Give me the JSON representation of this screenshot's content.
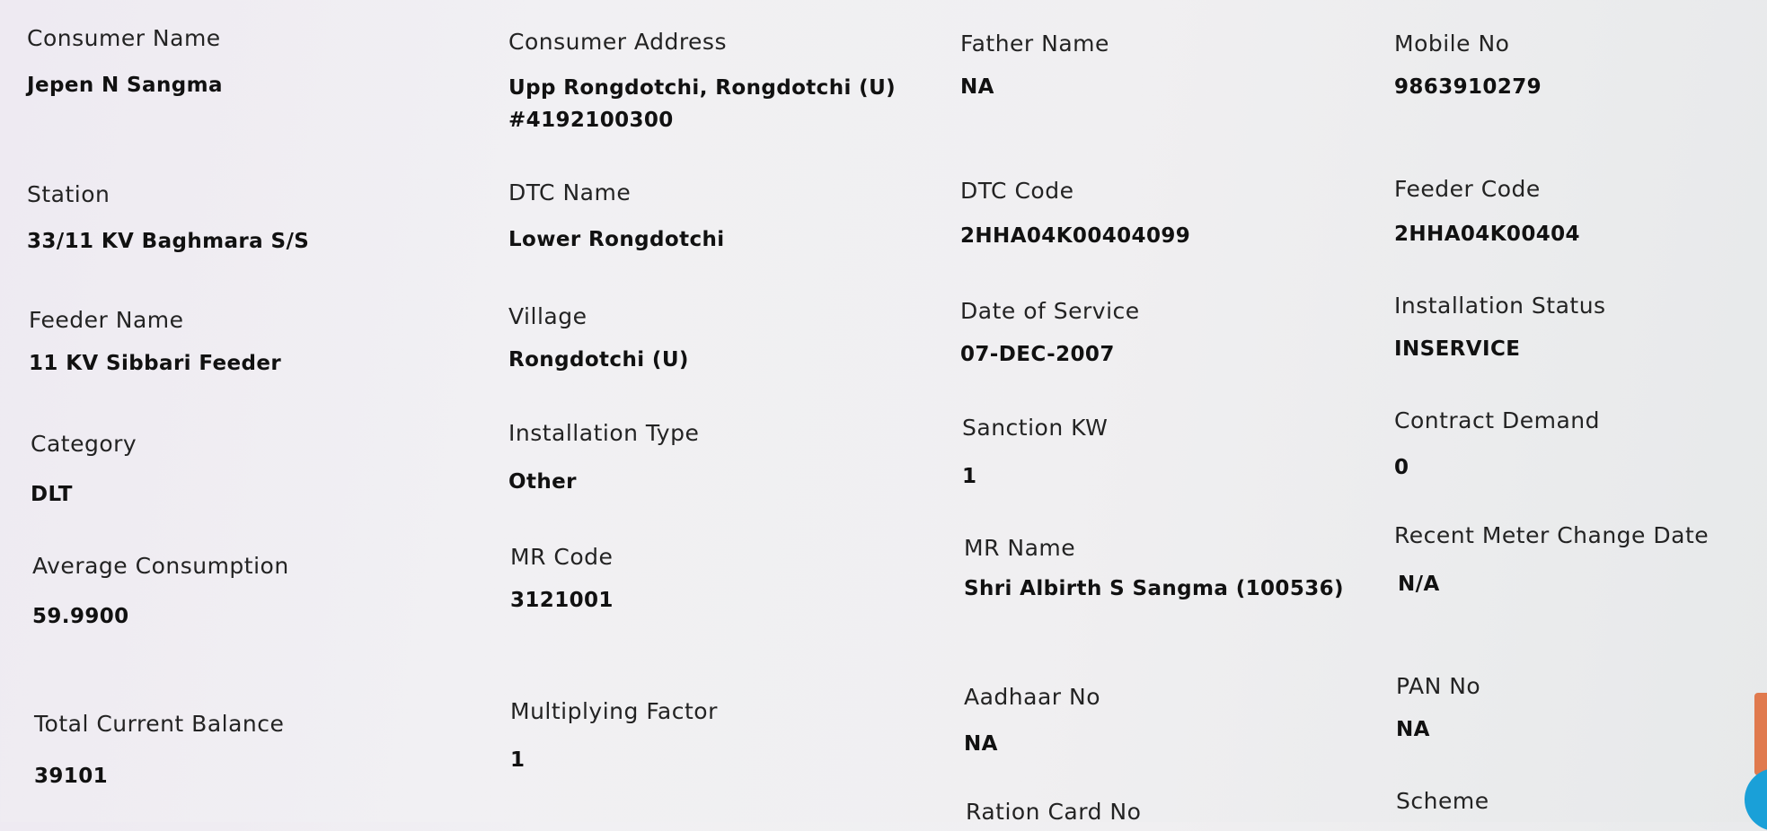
{
  "fields": {
    "consumer_name": {
      "label": "Consumer Name",
      "value": "Jepen N Sangma"
    },
    "consumer_address": {
      "label": "Consumer Address",
      "value": "Upp Rongdotchi, Rongdotchi (U) #4192100300"
    },
    "father_name": {
      "label": "Father Name",
      "value": "NA"
    },
    "mobile_no": {
      "label": "Mobile No",
      "value": "9863910279"
    },
    "station": {
      "label": "Station",
      "value": "33/11 KV Baghmara S/S"
    },
    "dtc_name": {
      "label": "DTC Name",
      "value": "Lower Rongdotchi"
    },
    "dtc_code": {
      "label": "DTC Code",
      "value": "2HHA04K00404099"
    },
    "feeder_code": {
      "label": "Feeder Code",
      "value": "2HHA04K00404"
    },
    "feeder_name": {
      "label": "Feeder Name",
      "value": "11 KV Sibbari Feeder"
    },
    "village": {
      "label": "Village",
      "value": "Rongdotchi (U)"
    },
    "date_of_service": {
      "label": "Date of Service",
      "value": "07-DEC-2007"
    },
    "installation_status": {
      "label": "Installation Status",
      "value": "INSERVICE"
    },
    "category": {
      "label": "Category",
      "value": "DLT"
    },
    "installation_type": {
      "label": "Installation Type",
      "value": "Other"
    },
    "sanction_kw": {
      "label": "Sanction KW",
      "value": "1"
    },
    "contract_demand": {
      "label": "Contract Demand",
      "value": "0"
    },
    "average_consumption": {
      "label": "Average Consumption",
      "value": "59.9900"
    },
    "mr_code": {
      "label": "MR Code",
      "value": "3121001"
    },
    "mr_name": {
      "label": "MR Name",
      "value": "Shri Albirth S Sangma (100536)"
    },
    "recent_meter_change_date": {
      "label": "Recent Meter Change Date",
      "value": "N/A"
    },
    "total_current_balance": {
      "label": "Total Current Balance",
      "value": "39101"
    },
    "multiplying_factor": {
      "label": "Multiplying Factor",
      "value": "1"
    },
    "aadhaar_no": {
      "label": "Aadhaar No",
      "value": "NA"
    },
    "pan_no": {
      "label": "PAN No",
      "value": "NA"
    },
    "ration_card_no": {
      "label": "Ration Card No",
      "value": ""
    },
    "scheme": {
      "label": "Scheme",
      "value": ""
    }
  },
  "colors": {
    "edge_tab": "#e07a4e",
    "edge_fab": "#1aa0d8"
  }
}
